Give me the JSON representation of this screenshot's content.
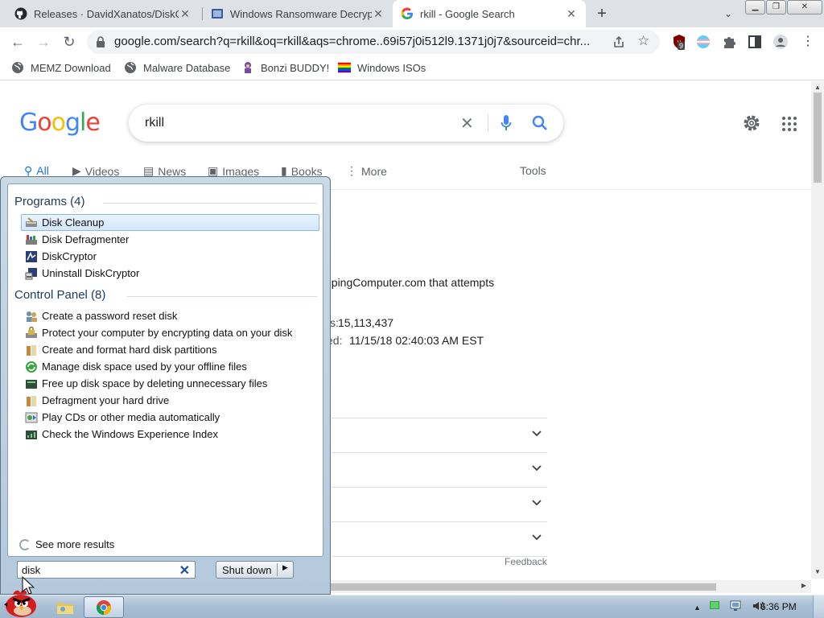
{
  "browser": {
    "tabs": [
      {
        "title": "Releases · DavidXanatos/DiskC",
        "active": false
      },
      {
        "title": "Windows Ransomware Decryp",
        "active": false
      },
      {
        "title": "rkill - Google Search",
        "active": true
      }
    ],
    "url": "google.com/search?q=rkill&oq=rkill&aqs=chrome..69i57j0i512l9.1371j0j7&sourceid=chr...",
    "extension_badge": "9",
    "bookmarks": [
      {
        "label": "MEMZ Download",
        "icon": "globe-icon"
      },
      {
        "label": "Malware Database",
        "icon": "globe-icon"
      },
      {
        "label": "Bonzi BUDDY!",
        "icon": "bonzi-icon"
      },
      {
        "label": "Windows ISOs",
        "icon": "rainbow-flag-icon"
      }
    ]
  },
  "google": {
    "logo": "Google",
    "query": "rkill",
    "tabs": [
      {
        "label": "All",
        "active": true
      },
      {
        "label": "Videos"
      },
      {
        "label": "News"
      },
      {
        "label": "Images"
      },
      {
        "label": "Books"
      },
      {
        "label": "More"
      }
    ],
    "tools": "Tools",
    "snippets": {
      "line1": "epingComputer.com that attempts",
      "line2_label": "s:",
      "line2_value": "15,113,437",
      "line3_label": "ed:",
      "line3_value": "11/15/18 02:40:03 AM EST"
    },
    "feedback": "Feedback"
  },
  "start_menu": {
    "programs_header": "Programs (4)",
    "programs": [
      {
        "label": "Disk Cleanup",
        "selected": true
      },
      {
        "label": "Disk Defragmenter"
      },
      {
        "label": "DiskCryptor"
      },
      {
        "label": "Uninstall DiskCryptor"
      }
    ],
    "control_panel_header": "Control Panel (8)",
    "control_panel": [
      {
        "label": "Create a password reset disk"
      },
      {
        "label": "Protect your computer by encrypting data on your disk"
      },
      {
        "label": "Create and format hard disk partitions"
      },
      {
        "label": "Manage disk space used by your offline files"
      },
      {
        "label": "Free up disk space by deleting unnecessary files"
      },
      {
        "label": "Defragment your hard drive"
      },
      {
        "label": "Play CDs or other media automatically"
      },
      {
        "label": "Check the Windows Experience Index"
      }
    ],
    "see_more": "See more results",
    "search_value": "disk",
    "shutdown_label": "Shut down"
  },
  "taskbar": {
    "clock": "6:36 PM"
  },
  "colors": {
    "google_blue": "#4285f4",
    "google_red": "#ea4335",
    "google_yellow": "#fbbc05",
    "google_green": "#34a853",
    "start_menu_group": "#1e395b"
  }
}
